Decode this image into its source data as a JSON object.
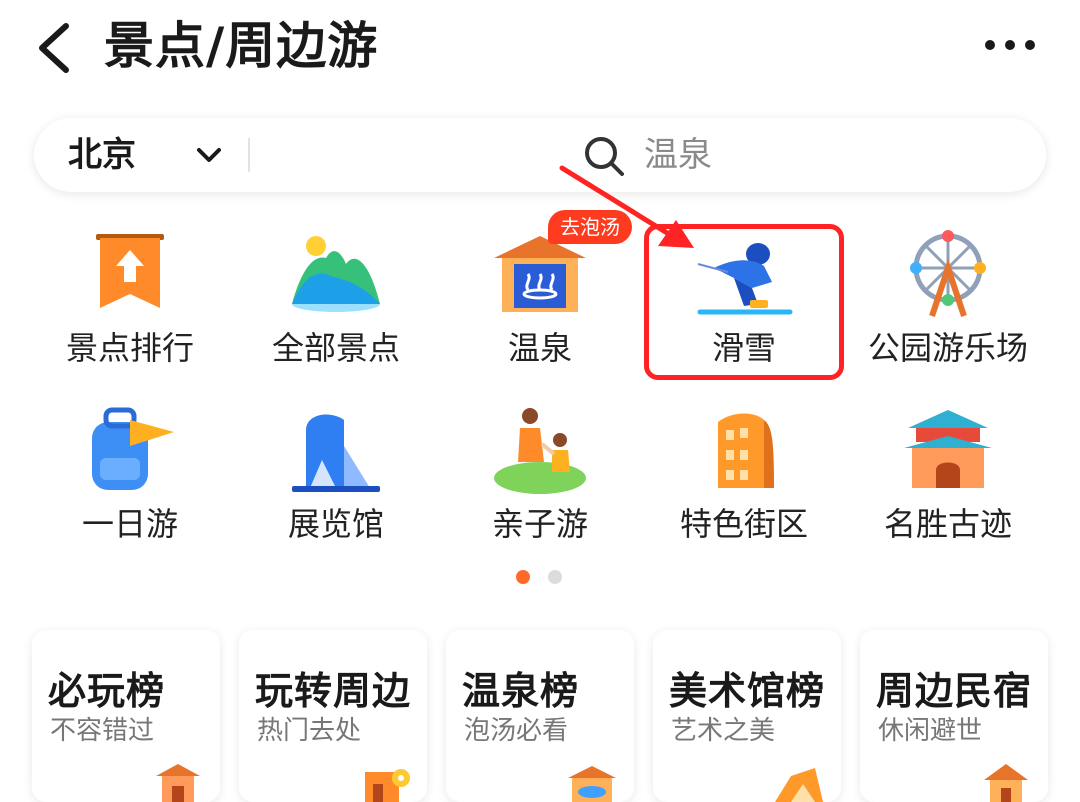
{
  "header": {
    "title": "景点/周边游",
    "back_icon": "chevron-left-icon",
    "more_icon": "more-dots-icon"
  },
  "search": {
    "city": "北京",
    "placeholder": "温泉",
    "icon": "search-icon"
  },
  "categories": [
    {
      "label": "景点排行",
      "icon": "ranking-banner-icon"
    },
    {
      "label": "全部景点",
      "icon": "mountains-icon"
    },
    {
      "label": "温泉",
      "icon": "hot-spring-icon",
      "badge": "去泡汤"
    },
    {
      "label": "滑雪",
      "icon": "skier-icon",
      "highlighted": true
    },
    {
      "label": "公园游乐场",
      "icon": "ferris-wheel-icon"
    },
    {
      "label": "一日游",
      "icon": "backpack-icon"
    },
    {
      "label": "展览馆",
      "icon": "exhibition-hall-icon"
    },
    {
      "label": "亲子游",
      "icon": "parent-child-icon"
    },
    {
      "label": "特色街区",
      "icon": "street-building-icon"
    },
    {
      "label": "名胜古迹",
      "icon": "ancient-gate-icon"
    }
  ],
  "pager": {
    "active_index": 0,
    "count": 2
  },
  "cards": [
    {
      "title": "必玩榜",
      "subtitle": "不容错过"
    },
    {
      "title": "玩转周边",
      "subtitle": "热门去处"
    },
    {
      "title": "温泉榜",
      "subtitle": "泡汤必看"
    },
    {
      "title": "美术馆榜",
      "subtitle": "艺术之美"
    },
    {
      "title": "周边民宿",
      "subtitle": "休闲避世"
    }
  ],
  "colors": {
    "accent": "#ff6a2b",
    "annotation_red": "#ff2323",
    "badge": "#ff3b1f"
  }
}
